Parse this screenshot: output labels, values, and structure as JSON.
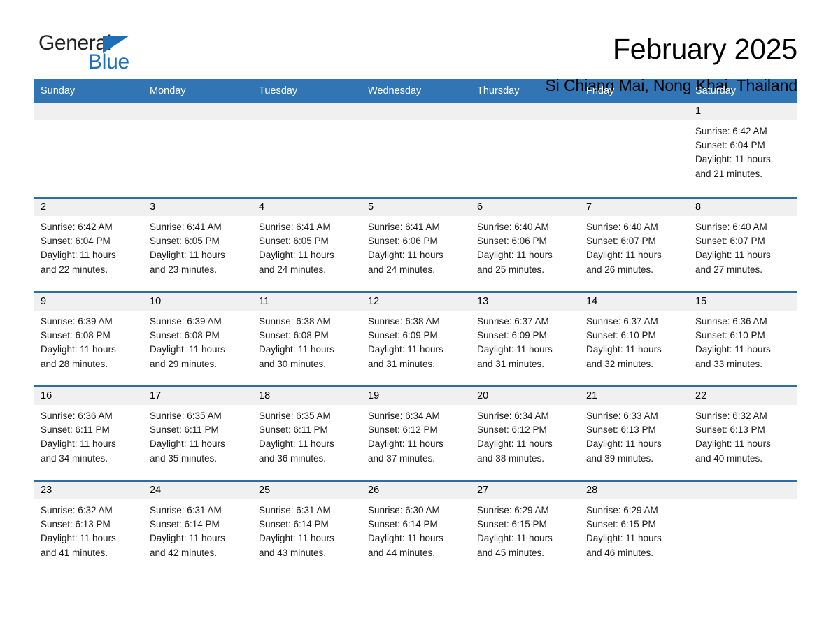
{
  "brand": {
    "name_top": "General",
    "name_bottom": "Blue",
    "accent_color": "#1d70b7"
  },
  "header": {
    "title": "February 2025",
    "subtitle": "Si Chiang Mai, Nong Khai, Thailand"
  },
  "theme": {
    "header_bg": "#3275b5",
    "row_divider": "#2e6da4",
    "day_band_bg": "#f0f0f0",
    "page_bg": "#ffffff",
    "text": "#000000"
  },
  "weekdays": [
    "Sunday",
    "Monday",
    "Tuesday",
    "Wednesday",
    "Thursday",
    "Friday",
    "Saturday"
  ],
  "weeks": [
    [
      {
        "day": "",
        "sunrise": "",
        "sunset": "",
        "daylight": "",
        "daylight2": ""
      },
      {
        "day": "",
        "sunrise": "",
        "sunset": "",
        "daylight": "",
        "daylight2": ""
      },
      {
        "day": "",
        "sunrise": "",
        "sunset": "",
        "daylight": "",
        "daylight2": ""
      },
      {
        "day": "",
        "sunrise": "",
        "sunset": "",
        "daylight": "",
        "daylight2": ""
      },
      {
        "day": "",
        "sunrise": "",
        "sunset": "",
        "daylight": "",
        "daylight2": ""
      },
      {
        "day": "",
        "sunrise": "",
        "sunset": "",
        "daylight": "",
        "daylight2": ""
      },
      {
        "day": "1",
        "sunrise": "Sunrise: 6:42 AM",
        "sunset": "Sunset: 6:04 PM",
        "daylight": "Daylight: 11 hours",
        "daylight2": "and 21 minutes."
      }
    ],
    [
      {
        "day": "2",
        "sunrise": "Sunrise: 6:42 AM",
        "sunset": "Sunset: 6:04 PM",
        "daylight": "Daylight: 11 hours",
        "daylight2": "and 22 minutes."
      },
      {
        "day": "3",
        "sunrise": "Sunrise: 6:41 AM",
        "sunset": "Sunset: 6:05 PM",
        "daylight": "Daylight: 11 hours",
        "daylight2": "and 23 minutes."
      },
      {
        "day": "4",
        "sunrise": "Sunrise: 6:41 AM",
        "sunset": "Sunset: 6:05 PM",
        "daylight": "Daylight: 11 hours",
        "daylight2": "and 24 minutes."
      },
      {
        "day": "5",
        "sunrise": "Sunrise: 6:41 AM",
        "sunset": "Sunset: 6:06 PM",
        "daylight": "Daylight: 11 hours",
        "daylight2": "and 24 minutes."
      },
      {
        "day": "6",
        "sunrise": "Sunrise: 6:40 AM",
        "sunset": "Sunset: 6:06 PM",
        "daylight": "Daylight: 11 hours",
        "daylight2": "and 25 minutes."
      },
      {
        "day": "7",
        "sunrise": "Sunrise: 6:40 AM",
        "sunset": "Sunset: 6:07 PM",
        "daylight": "Daylight: 11 hours",
        "daylight2": "and 26 minutes."
      },
      {
        "day": "8",
        "sunrise": "Sunrise: 6:40 AM",
        "sunset": "Sunset: 6:07 PM",
        "daylight": "Daylight: 11 hours",
        "daylight2": "and 27 minutes."
      }
    ],
    [
      {
        "day": "9",
        "sunrise": "Sunrise: 6:39 AM",
        "sunset": "Sunset: 6:08 PM",
        "daylight": "Daylight: 11 hours",
        "daylight2": "and 28 minutes."
      },
      {
        "day": "10",
        "sunrise": "Sunrise: 6:39 AM",
        "sunset": "Sunset: 6:08 PM",
        "daylight": "Daylight: 11 hours",
        "daylight2": "and 29 minutes."
      },
      {
        "day": "11",
        "sunrise": "Sunrise: 6:38 AM",
        "sunset": "Sunset: 6:08 PM",
        "daylight": "Daylight: 11 hours",
        "daylight2": "and 30 minutes."
      },
      {
        "day": "12",
        "sunrise": "Sunrise: 6:38 AM",
        "sunset": "Sunset: 6:09 PM",
        "daylight": "Daylight: 11 hours",
        "daylight2": "and 31 minutes."
      },
      {
        "day": "13",
        "sunrise": "Sunrise: 6:37 AM",
        "sunset": "Sunset: 6:09 PM",
        "daylight": "Daylight: 11 hours",
        "daylight2": "and 31 minutes."
      },
      {
        "day": "14",
        "sunrise": "Sunrise: 6:37 AM",
        "sunset": "Sunset: 6:10 PM",
        "daylight": "Daylight: 11 hours",
        "daylight2": "and 32 minutes."
      },
      {
        "day": "15",
        "sunrise": "Sunrise: 6:36 AM",
        "sunset": "Sunset: 6:10 PM",
        "daylight": "Daylight: 11 hours",
        "daylight2": "and 33 minutes."
      }
    ],
    [
      {
        "day": "16",
        "sunrise": "Sunrise: 6:36 AM",
        "sunset": "Sunset: 6:11 PM",
        "daylight": "Daylight: 11 hours",
        "daylight2": "and 34 minutes."
      },
      {
        "day": "17",
        "sunrise": "Sunrise: 6:35 AM",
        "sunset": "Sunset: 6:11 PM",
        "daylight": "Daylight: 11 hours",
        "daylight2": "and 35 minutes."
      },
      {
        "day": "18",
        "sunrise": "Sunrise: 6:35 AM",
        "sunset": "Sunset: 6:11 PM",
        "daylight": "Daylight: 11 hours",
        "daylight2": "and 36 minutes."
      },
      {
        "day": "19",
        "sunrise": "Sunrise: 6:34 AM",
        "sunset": "Sunset: 6:12 PM",
        "daylight": "Daylight: 11 hours",
        "daylight2": "and 37 minutes."
      },
      {
        "day": "20",
        "sunrise": "Sunrise: 6:34 AM",
        "sunset": "Sunset: 6:12 PM",
        "daylight": "Daylight: 11 hours",
        "daylight2": "and 38 minutes."
      },
      {
        "day": "21",
        "sunrise": "Sunrise: 6:33 AM",
        "sunset": "Sunset: 6:13 PM",
        "daylight": "Daylight: 11 hours",
        "daylight2": "and 39 minutes."
      },
      {
        "day": "22",
        "sunrise": "Sunrise: 6:32 AM",
        "sunset": "Sunset: 6:13 PM",
        "daylight": "Daylight: 11 hours",
        "daylight2": "and 40 minutes."
      }
    ],
    [
      {
        "day": "23",
        "sunrise": "Sunrise: 6:32 AM",
        "sunset": "Sunset: 6:13 PM",
        "daylight": "Daylight: 11 hours",
        "daylight2": "and 41 minutes."
      },
      {
        "day": "24",
        "sunrise": "Sunrise: 6:31 AM",
        "sunset": "Sunset: 6:14 PM",
        "daylight": "Daylight: 11 hours",
        "daylight2": "and 42 minutes."
      },
      {
        "day": "25",
        "sunrise": "Sunrise: 6:31 AM",
        "sunset": "Sunset: 6:14 PM",
        "daylight": "Daylight: 11 hours",
        "daylight2": "and 43 minutes."
      },
      {
        "day": "26",
        "sunrise": "Sunrise: 6:30 AM",
        "sunset": "Sunset: 6:14 PM",
        "daylight": "Daylight: 11 hours",
        "daylight2": "and 44 minutes."
      },
      {
        "day": "27",
        "sunrise": "Sunrise: 6:29 AM",
        "sunset": "Sunset: 6:15 PM",
        "daylight": "Daylight: 11 hours",
        "daylight2": "and 45 minutes."
      },
      {
        "day": "28",
        "sunrise": "Sunrise: 6:29 AM",
        "sunset": "Sunset: 6:15 PM",
        "daylight": "Daylight: 11 hours",
        "daylight2": "and 46 minutes."
      },
      {
        "day": "",
        "sunrise": "",
        "sunset": "",
        "daylight": "",
        "daylight2": ""
      }
    ]
  ]
}
